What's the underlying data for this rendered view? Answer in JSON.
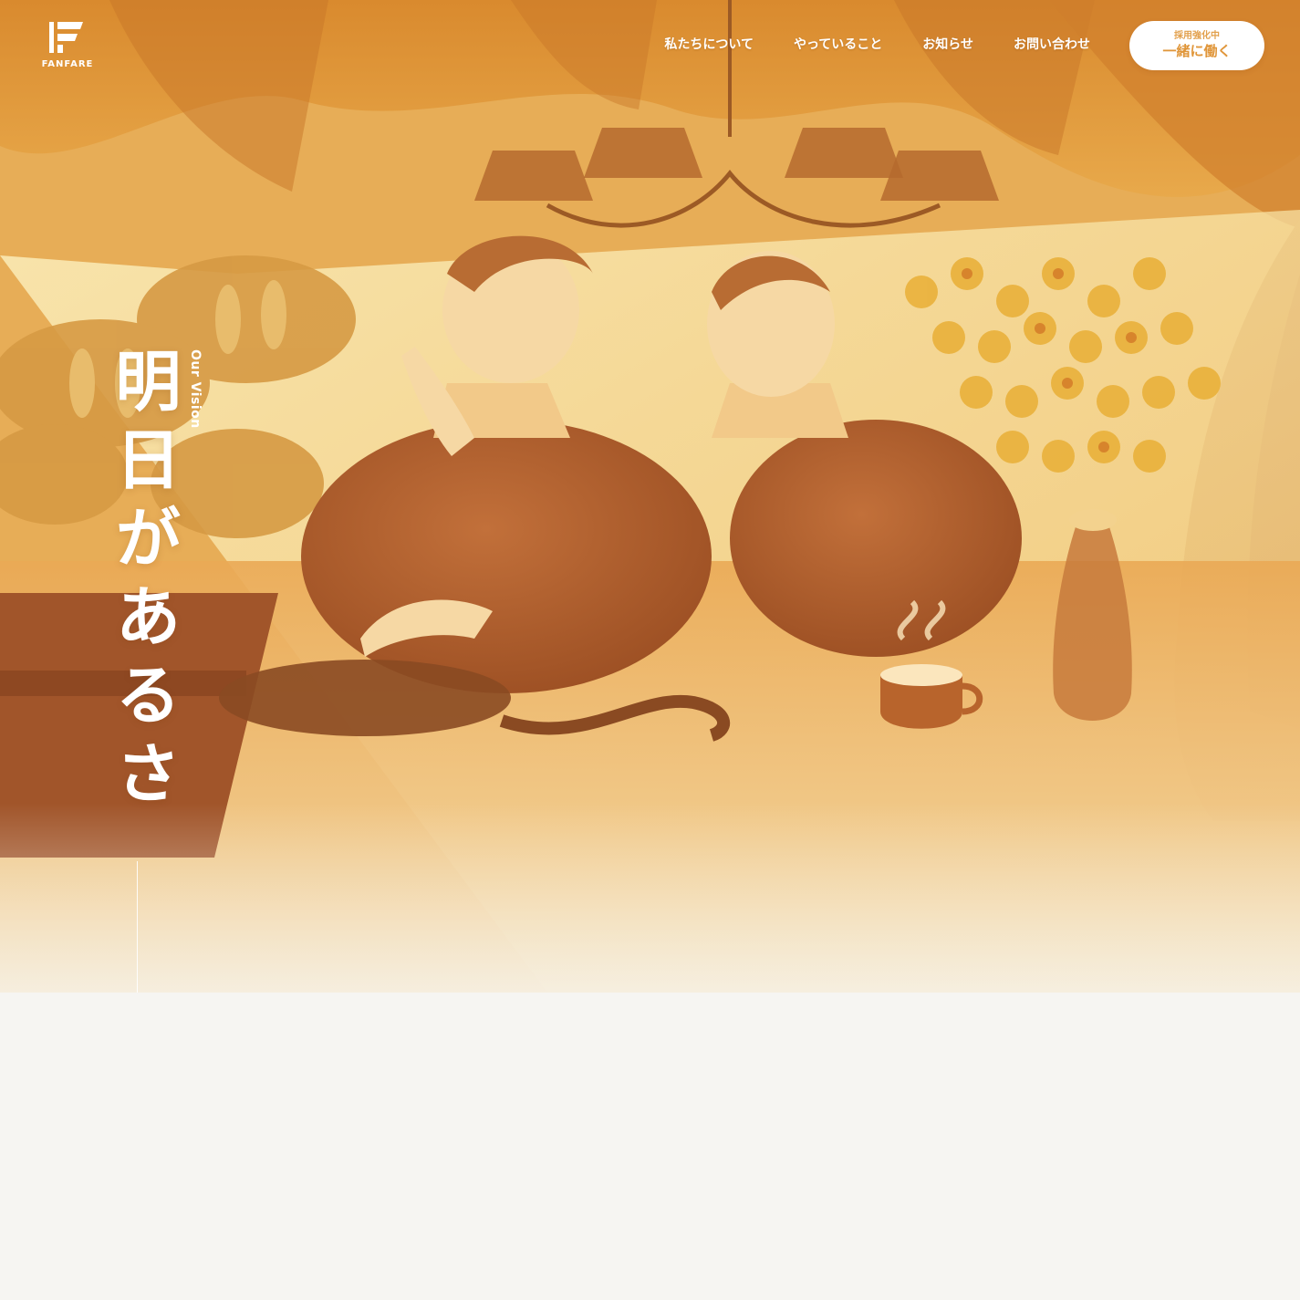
{
  "header": {
    "logo": {
      "text": "FANFARE"
    },
    "nav": [
      {
        "label": "私たちについて"
      },
      {
        "label": "やっていること"
      },
      {
        "label": "お知らせ"
      },
      {
        "label": "お問い合わせ"
      }
    ],
    "recruit": {
      "sub": "採用強化中",
      "main": "一緒に働く"
    }
  },
  "hero": {
    "vision_label": "Our Vision",
    "title": "明日があるさ"
  },
  "colors": {
    "accent_orange": "#e0963a",
    "hero_gold": "#eab863",
    "page_background": "#f6f5f2",
    "text_white": "#ffffff"
  }
}
